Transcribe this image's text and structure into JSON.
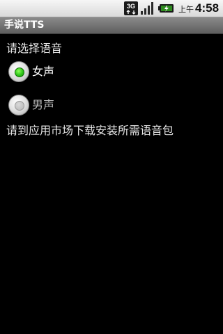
{
  "status_bar": {
    "network_label": "3G",
    "ampm": "上午",
    "time": "4:58",
    "icons": [
      "network-3g-icon",
      "signal-strength-icon",
      "battery-charging-icon"
    ]
  },
  "app": {
    "title": "手说TTS"
  },
  "voice_select": {
    "prompt": "请选择语音",
    "options": [
      {
        "label": "女声",
        "selected": true
      },
      {
        "label": "男声",
        "selected": false
      }
    ]
  },
  "hint": "请到应用市场下载安装所需语音包",
  "colors": {
    "background": "#000000",
    "radio_selected": "#2fc51a",
    "title_bar": "#6e6e6e"
  }
}
